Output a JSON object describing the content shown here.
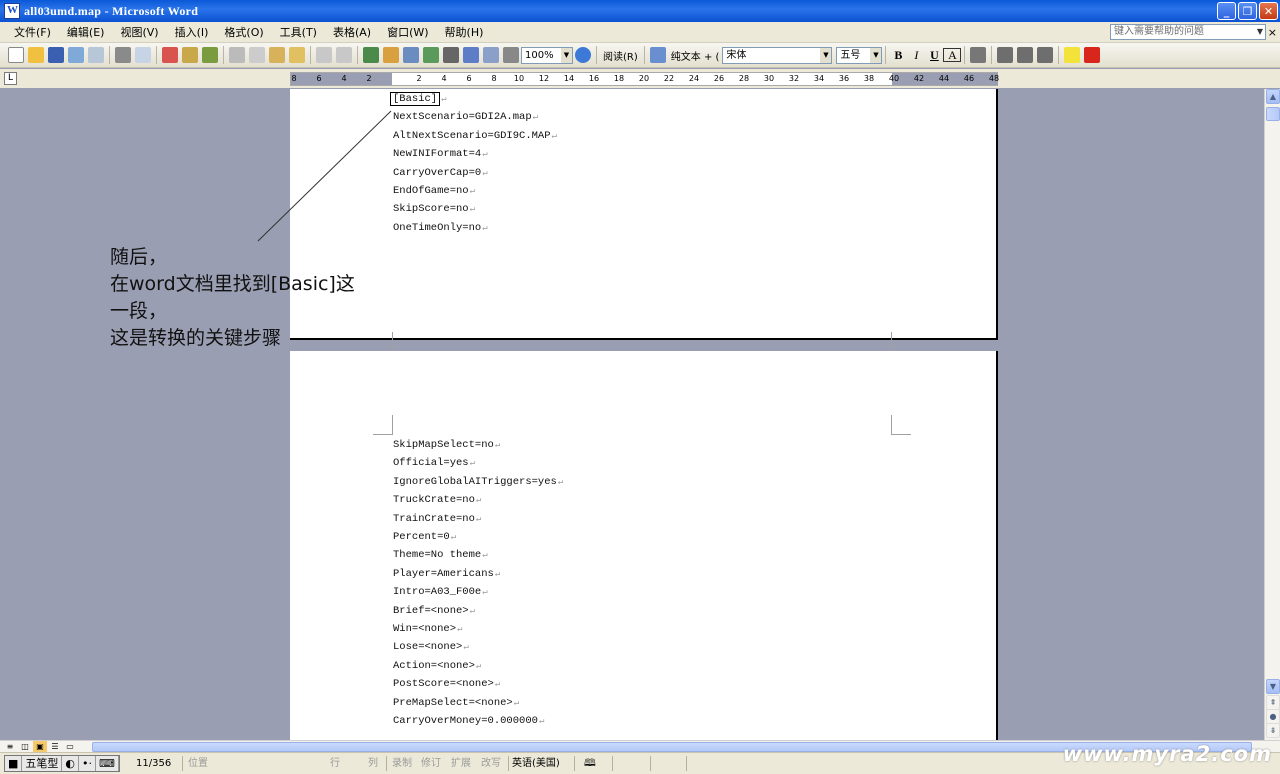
{
  "window": {
    "title": "all03umd.map - Microsoft Word",
    "minimize_label": "_",
    "restore_label": "❐",
    "close_label": "✕"
  },
  "menu": {
    "items": [
      "文件(F)",
      "编辑(E)",
      "视图(V)",
      "插入(I)",
      "格式(O)",
      "工具(T)",
      "表格(A)",
      "窗口(W)",
      "帮助(H)"
    ],
    "help_placeholder": "键入需要帮助的问题"
  },
  "toolbar": {
    "zoom": "100%",
    "read_label": "阅读(R)",
    "style": "纯文本 + (",
    "font": "宋体",
    "font_size": "五号",
    "bold": "B",
    "italic": "I",
    "underline": "U",
    "char_box": "A"
  },
  "ruler": {
    "corner": "L",
    "ticks": [
      "8",
      "6",
      "4",
      "2",
      "2",
      "4",
      "6",
      "8",
      "10",
      "12",
      "14",
      "16",
      "18",
      "20",
      "22",
      "24",
      "26",
      "28",
      "30",
      "32",
      "34",
      "36",
      "38",
      "40",
      "42",
      "44",
      "46",
      "48"
    ]
  },
  "document": {
    "page1_lines": [
      "[Basic]",
      "NextScenario=GDI2A.map",
      "AltNextScenario=GDI9C.MAP",
      "NewINIFormat=4",
      "CarryOverCap=0",
      "EndOfGame=no",
      "SkipScore=no",
      "OneTimeOnly=no"
    ],
    "page2_lines": [
      "SkipMapSelect=no",
      "Official=yes",
      "IgnoreGlobalAITriggers=yes",
      "TruckCrate=no",
      "TrainCrate=no",
      "Percent=0",
      "Theme=No theme",
      "Player=Americans",
      "Intro=A03_F00e",
      "Brief=<none>",
      "Win=<none>",
      "Lose=<none>",
      "Action=<none>",
      "PostScore=<none>",
      "PreMapSelect=<none>",
      "CarryOverMoney=0.000000"
    ],
    "paragraph_mark": "↵"
  },
  "annotation": {
    "lines": [
      "随后，",
      "在word文档里找到[Basic]这",
      "一段，",
      "这是转换的关键步骤"
    ]
  },
  "statusbar": {
    "ime_mode": "五笔型",
    "page_count": "11/356",
    "position": "位置",
    "line": "行",
    "column": "列",
    "record": "录制",
    "revise": "修订",
    "extend": "扩展",
    "overwrite": "改写",
    "language": "英语(美国)"
  },
  "watermark": "www.myra2.com"
}
